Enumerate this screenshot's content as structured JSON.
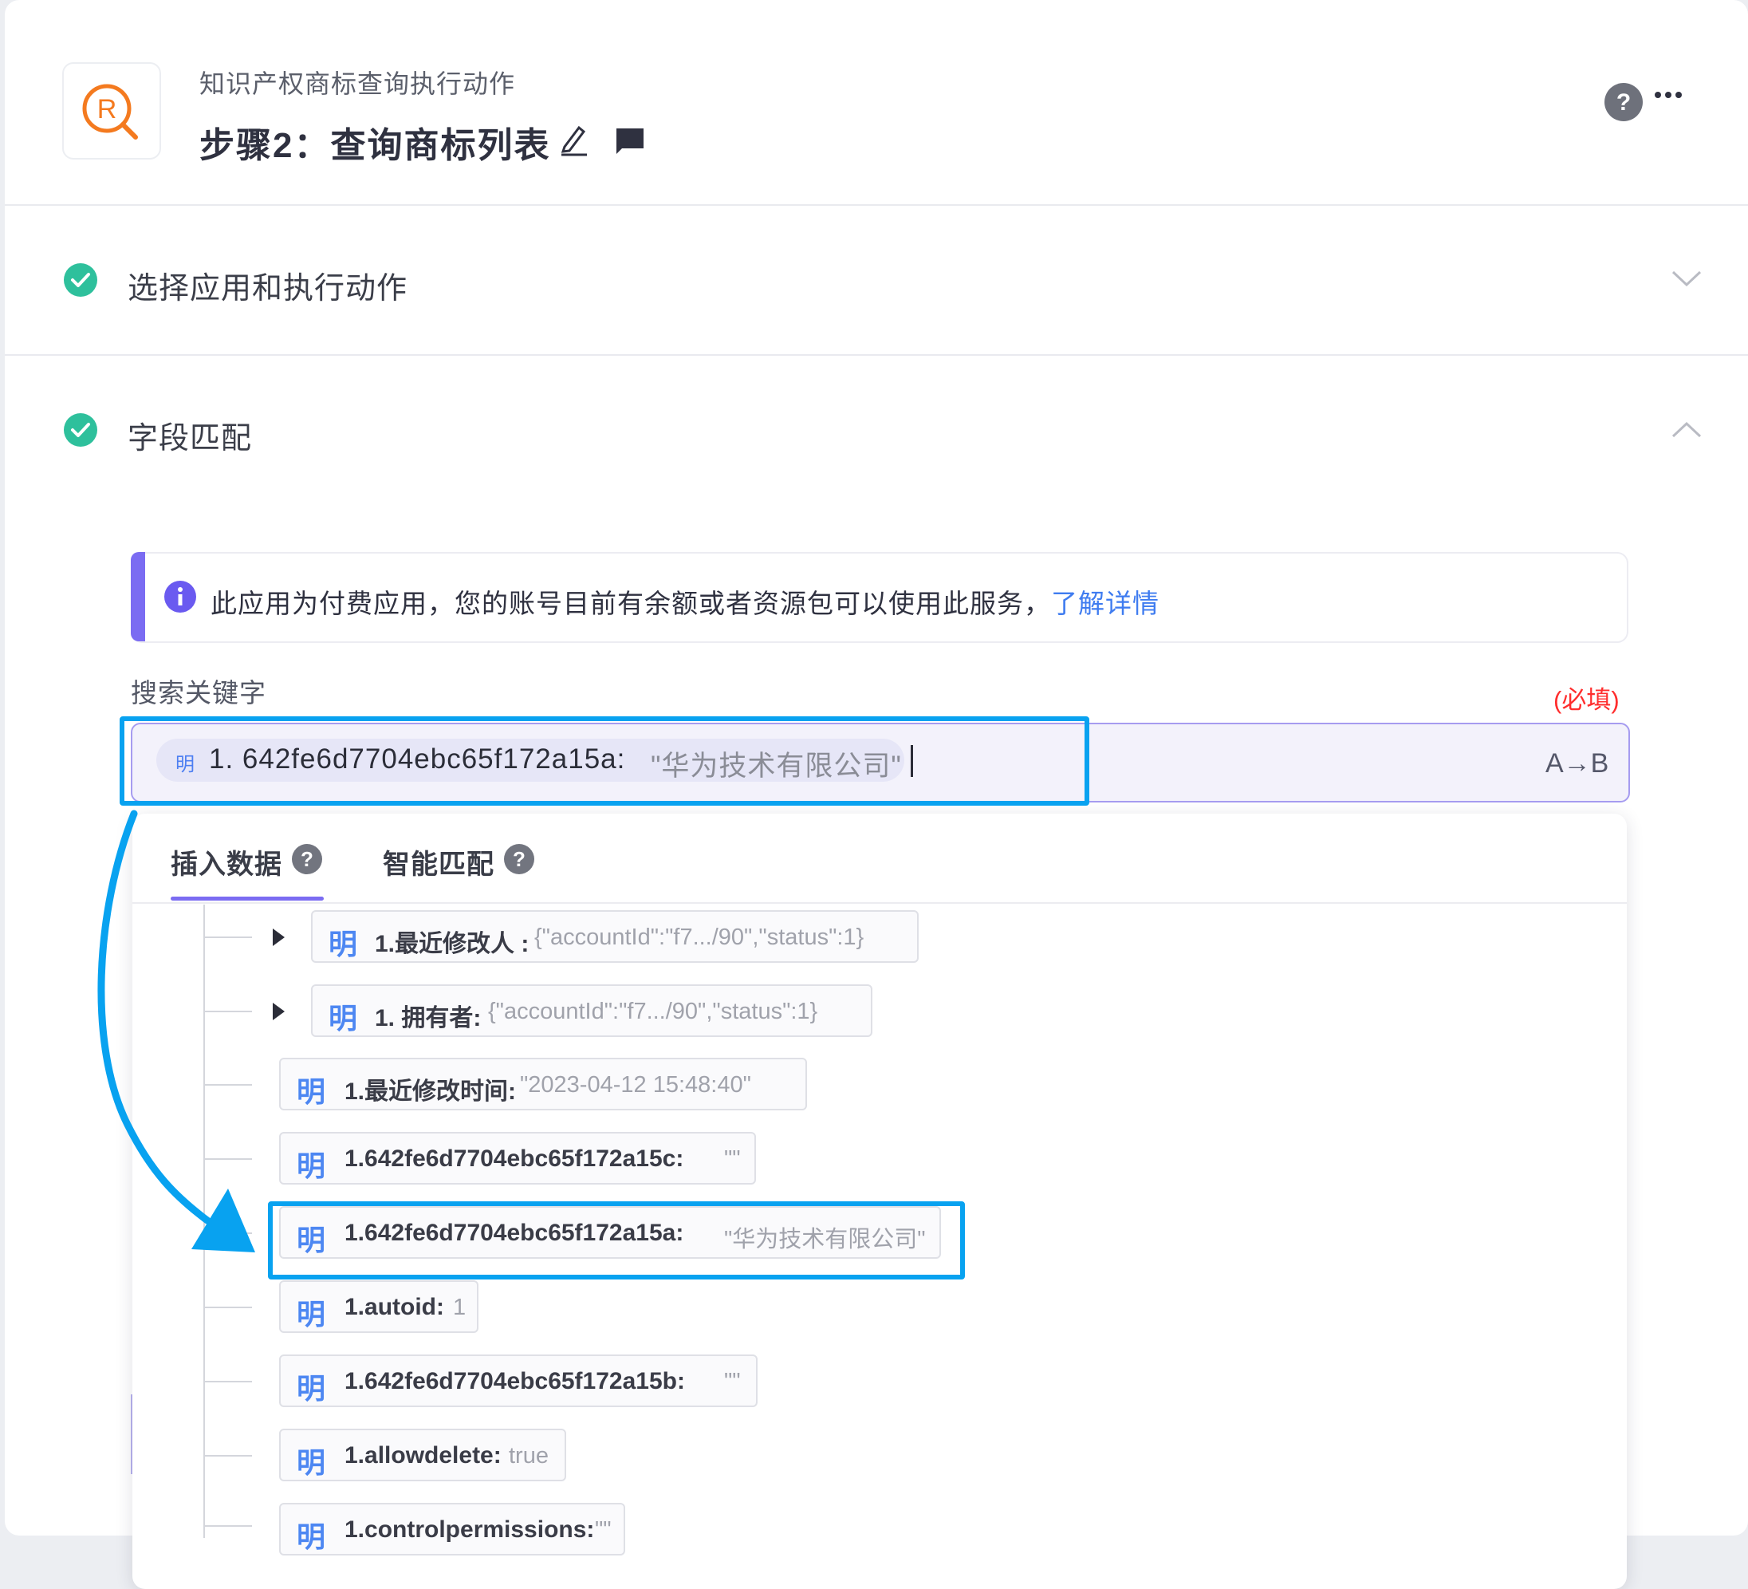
{
  "header": {
    "app_name": "知识产权商标查询执行动作",
    "step_title": "步骤2：查询商标列表",
    "logo_icon": "trademark-search-logo",
    "accent_color": "#f47a1f"
  },
  "sections": [
    {
      "label": "选择应用和执行动作",
      "status": "complete",
      "expanded": false
    },
    {
      "label": "字段匹配",
      "status": "complete",
      "expanded": true
    }
  ],
  "info_banner": {
    "text": "此应用为付费应用，您的账号目前有余额或者资源包可以使用此服务，",
    "link": "了解详情"
  },
  "field": {
    "label": "搜索关键字",
    "required": "(必填)",
    "token_icon": "明",
    "token_key": "1. 642fe6d7704ebc65f172a15a:",
    "token_value": "\"华为技术有限公司\"",
    "transform_label": "A→B"
  },
  "tabs": [
    {
      "label": "插入数据",
      "active": true
    },
    {
      "label": "智能匹配",
      "active": false
    }
  ],
  "tree_items": [
    {
      "icon": "明",
      "key": "1.最近修改人 :",
      "value": "{\"accountId\":\"f7.../90\",\"status\":1}",
      "expandable": true
    },
    {
      "icon": "明",
      "key": "1. 拥有者:",
      "value": "{\"accountId\":\"f7.../90\",\"status\":1}",
      "expandable": true
    },
    {
      "icon": "明",
      "key": "1.最近修改时间:",
      "value": "\"2023-04-12 15:48:40\"",
      "expandable": false
    },
    {
      "icon": "明",
      "key": "1.642fe6d7704ebc65f172a15c:",
      "value": "\"\"",
      "expandable": false
    },
    {
      "icon": "明",
      "key": "1.642fe6d7704ebc65f172a15a:",
      "value": "\"华为技术有限公司\"",
      "expandable": false,
      "highlighted": true
    },
    {
      "icon": "明",
      "key": "1.autoid:",
      "value": "1",
      "expandable": false
    },
    {
      "icon": "明",
      "key": "1.642fe6d7704ebc65f172a15b:",
      "value": "\"\"",
      "expandable": false
    },
    {
      "icon": "明",
      "key": "1.allowdelete:",
      "value": "true",
      "expandable": false
    },
    {
      "icon": "明",
      "key": "1.controlpermissions:",
      "value": "\"\"",
      "expandable": false
    }
  ],
  "colors": {
    "check": "#2ec09c",
    "accent_purple": "#7b6cf2",
    "highlight_blue": "#08a2f0",
    "link_blue": "#3f7cf0",
    "required_red": "#ff2d2d"
  }
}
